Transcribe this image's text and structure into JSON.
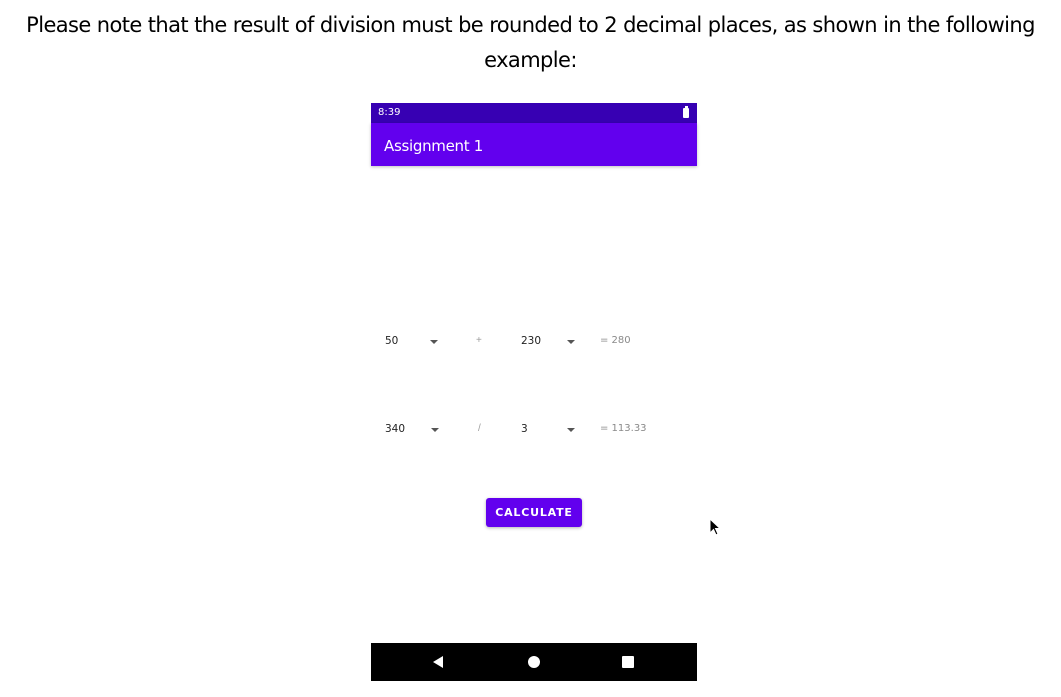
{
  "note": {
    "line1": "Please note that the result of division must be rounded to 2 decimal places, as shown in the following",
    "line2": "example:"
  },
  "phone": {
    "status_bar": {
      "time": "8:39",
      "battery_icon": "battery-full-icon"
    },
    "app_bar": {
      "title": "Assignment 1"
    },
    "rows": [
      {
        "left_value": "50",
        "operator": "+",
        "right_value": "230",
        "result": "= 280"
      },
      {
        "left_value": "340",
        "operator": "/",
        "right_value": "3",
        "result": "= 113.33"
      }
    ],
    "calculate_label": "CALCULATE",
    "nav_bar": {
      "back": "back-icon",
      "home": "home-icon",
      "recents": "recents-icon"
    }
  },
  "colors": {
    "primary": "#6200ee",
    "primary_dark": "#3700b3"
  }
}
